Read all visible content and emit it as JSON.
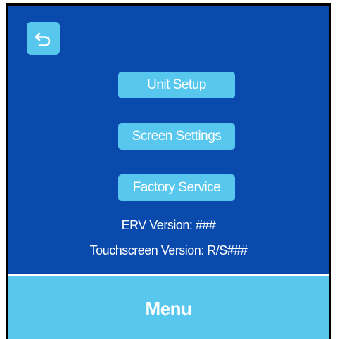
{
  "colors": {
    "background": "#0a4aad",
    "accent": "#58c7ee",
    "text": "#ffffff",
    "frame": "#000000"
  },
  "header": {
    "back_icon": "back-arrow-icon"
  },
  "menu": {
    "unit_setup_label": "Unit Setup",
    "screen_settings_label": "Screen Settings",
    "factory_service_label": "Factory Service"
  },
  "info": {
    "erv_version": "ERV Version: ###",
    "touchscreen_version": "Touchscreen Version: R/S###"
  },
  "footer": {
    "title": "Menu"
  }
}
